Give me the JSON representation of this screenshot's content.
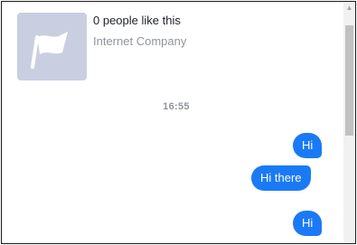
{
  "page": {
    "likes_text": "0 people like this",
    "category": "Internet Company",
    "avatar_icon": "flag-icon"
  },
  "conversation": {
    "timestamp": "16:55",
    "messages": [
      {
        "text": "Hi",
        "from": "self"
      },
      {
        "text": "Hi there",
        "from": "self"
      },
      {
        "text": "Hi",
        "from": "self"
      }
    ]
  },
  "colors": {
    "bubble_blue": "#1a7af5",
    "avatar_bg": "#c9cfe0",
    "secondary_text": "#90949c"
  }
}
